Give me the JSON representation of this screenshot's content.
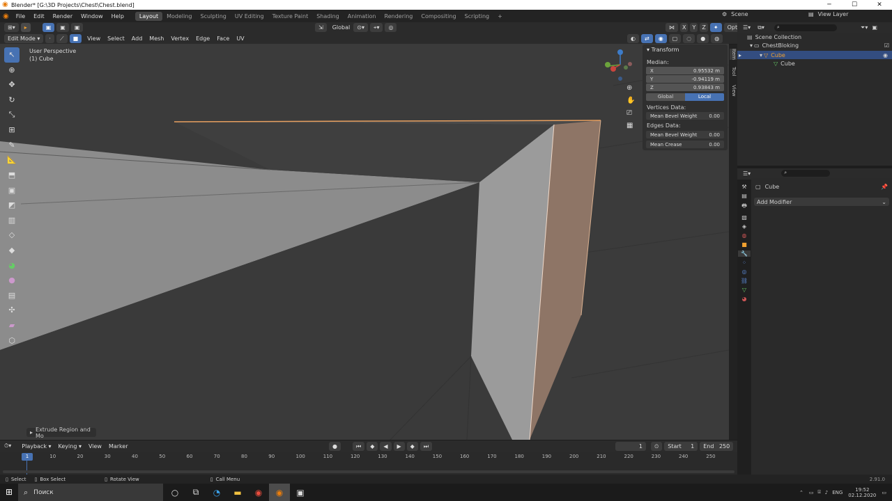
{
  "window": {
    "title": "Blender* [G:\\3D Projects\\Chest\\Chest.blend]",
    "min": "─",
    "max": "☐",
    "close": "✕"
  },
  "menu": [
    "File",
    "Edit",
    "Render",
    "Window",
    "Help"
  ],
  "workspaces": [
    {
      "label": "Layout",
      "active": true
    },
    {
      "label": "Modeling"
    },
    {
      "label": "Sculpting"
    },
    {
      "label": "UV Editing"
    },
    {
      "label": "Texture Paint"
    },
    {
      "label": "Shading"
    },
    {
      "label": "Animation"
    },
    {
      "label": "Rendering"
    },
    {
      "label": "Compositing"
    },
    {
      "label": "Scripting"
    }
  ],
  "scene": {
    "name": "Scene",
    "view_layer": "View Layer"
  },
  "viewport_header": {
    "orientation": "Global",
    "options": "Options",
    "axes": [
      "X",
      "Y",
      "Z"
    ]
  },
  "edit_header": {
    "mode": "Edit Mode",
    "menus": [
      "View",
      "Select",
      "Add",
      "Mesh",
      "Vertex",
      "Edge",
      "Face",
      "UV"
    ]
  },
  "overlay_text": {
    "perspective": "User Perspective",
    "object": "(1) Cube"
  },
  "operator_panel": "Extrude Region and Mo",
  "npanel": {
    "header": "Transform",
    "median": "Median:",
    "fields": [
      {
        "label": "X",
        "value": "0.95532 m"
      },
      {
        "label": "Y",
        "value": "-0.94119 m"
      },
      {
        "label": "Z",
        "value": "0.93843 m"
      }
    ],
    "toggle": {
      "global": "Global",
      "local": "Local"
    },
    "vertices_data": "Vertices Data:",
    "vertex_bevel": {
      "label": "Mean Bevel Weight",
      "value": "0.00"
    },
    "edges_data": "Edges Data:",
    "edge_bevel": {
      "label": "Mean Bevel Weight",
      "value": "0.00"
    },
    "crease": {
      "label": "Mean Crease",
      "value": "0.00"
    },
    "tabs": [
      "Item",
      "Tool",
      "View"
    ]
  },
  "outliner": {
    "scene_collection": "Scene Collection",
    "collection": "ChestBloking",
    "object": "Cube",
    "mesh": "Cube"
  },
  "properties": {
    "object": "Cube",
    "add_modifier": "Add Modifier"
  },
  "timeline": {
    "menus": [
      "Playback",
      "Keying",
      "View",
      "Marker"
    ],
    "current_frame": "1",
    "start_label": "Start",
    "start": "1",
    "end_label": "End",
    "end": "250",
    "ticks": [
      "10",
      "20",
      "30",
      "40",
      "50",
      "60",
      "70",
      "80",
      "90",
      "100",
      "110",
      "120",
      "130",
      "140",
      "150",
      "160",
      "170",
      "180",
      "190",
      "200",
      "210",
      "220",
      "230",
      "240",
      "250"
    ],
    "cursor": "1"
  },
  "status": {
    "select": "Select",
    "box_select": "Box Select",
    "rotate": "Rotate View",
    "call_menu": "Call Menu",
    "version": "2.91.0"
  },
  "taskbar": {
    "search": "Поиск",
    "lang": "ENG",
    "time": "19:52",
    "date": "02.12.2020"
  },
  "colors": {
    "accent": "#4772b3",
    "selected_edge": "#e8a060",
    "selected_face": "#8e7566",
    "highlight": "#f0a030"
  }
}
